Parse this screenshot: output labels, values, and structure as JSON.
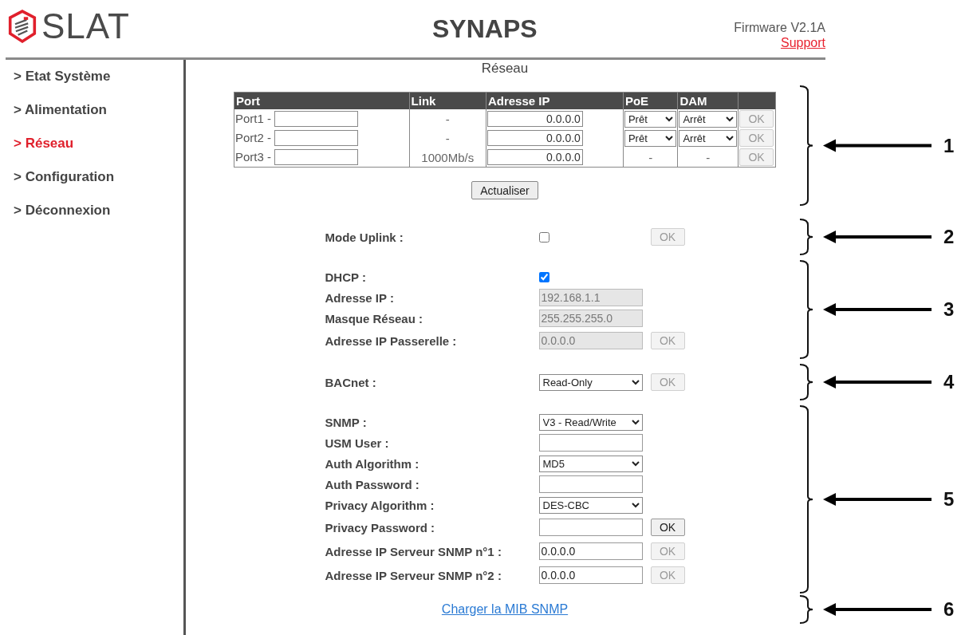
{
  "header": {
    "logo_text": "SLAT",
    "title": "SYNAPS",
    "firmware": "Firmware V2.1A",
    "support_link": "Support"
  },
  "sidebar": {
    "items": [
      {
        "label": "> Etat Système",
        "selected": false
      },
      {
        "label": "> Alimentation",
        "selected": false
      },
      {
        "label": "> Réseau",
        "selected": true
      },
      {
        "label": "> Configuration",
        "selected": false
      },
      {
        "label": "> Déconnexion",
        "selected": false
      }
    ]
  },
  "page_title": "Réseau",
  "ports_table": {
    "columns": [
      "Port",
      "Link",
      "Adresse IP",
      "PoE",
      "DAM"
    ],
    "rows": [
      {
        "port": "Port1 -",
        "link": "-",
        "ip": "0.0.0.0",
        "poe": {
          "kind": "select",
          "value": "Prêt"
        },
        "dam": {
          "kind": "select",
          "value": "Arrêt"
        },
        "ok": {
          "label": "OK",
          "disabled": true
        }
      },
      {
        "port": "Port2 -",
        "link": "-",
        "ip": "0.0.0.0",
        "poe": {
          "kind": "select",
          "value": "Prêt"
        },
        "dam": {
          "kind": "select",
          "value": "Arrêt"
        },
        "ok": {
          "label": "OK",
          "disabled": true
        }
      },
      {
        "port": "Port3 -",
        "link": "1000Mb/s",
        "ip": "0.0.0.0",
        "poe": {
          "kind": "text",
          "value": "-"
        },
        "dam": {
          "kind": "text",
          "value": "-"
        },
        "ok": {
          "label": "OK",
          "disabled": true
        }
      }
    ],
    "refresh_button": "Actualiser"
  },
  "form_groups": [
    {
      "rows": [
        {
          "label": "Mode Uplink :",
          "control": {
            "kind": "checkbox",
            "checked": false
          },
          "ok": {
            "label": "OK",
            "disabled": true
          }
        }
      ]
    },
    {
      "rows": [
        {
          "label": "DHCP :",
          "control": {
            "kind": "checkbox",
            "checked": true
          }
        },
        {
          "label": "Adresse IP :",
          "control": {
            "kind": "text",
            "value": "192.168.1.1",
            "disabled": true
          }
        },
        {
          "label": "Masque Réseau :",
          "control": {
            "kind": "text",
            "value": "255.255.255.0",
            "disabled": true
          }
        },
        {
          "label": "Adresse IP Passerelle :",
          "control": {
            "kind": "text",
            "value": "0.0.0.0",
            "disabled": true
          },
          "ok": {
            "label": "OK",
            "disabled": true
          }
        }
      ]
    },
    {
      "rows": [
        {
          "label": "BACnet :",
          "control": {
            "kind": "select",
            "value": "Read-Only"
          },
          "ok": {
            "label": "OK",
            "disabled": true
          }
        }
      ]
    },
    {
      "rows": [
        {
          "label": "SNMP :",
          "control": {
            "kind": "select",
            "value": "V3 - Read/Write"
          }
        },
        {
          "label": "USM User :",
          "control": {
            "kind": "text",
            "disabled": false
          }
        },
        {
          "label": "Auth Algorithm :",
          "control": {
            "kind": "select",
            "value": "MD5"
          }
        },
        {
          "label": "Auth Password :",
          "control": {
            "kind": "text",
            "disabled": false
          }
        },
        {
          "label": "Privacy Algorithm :",
          "control": {
            "kind": "select",
            "value": "DES-CBC"
          }
        },
        {
          "label": "Privacy Password :",
          "control": {
            "kind": "text",
            "disabled": false
          },
          "ok": {
            "label": "OK",
            "disabled": false
          }
        },
        {
          "label": "Adresse IP Serveur SNMP n°1 :",
          "control": {
            "kind": "text",
            "value": "0.0.0.0",
            "disabled": false
          },
          "ok": {
            "label": "OK",
            "disabled": true
          }
        },
        {
          "label": "Adresse IP Serveur SNMP n°2 :",
          "control": {
            "kind": "text",
            "value": "0.0.0.0",
            "disabled": false
          },
          "ok": {
            "label": "OK",
            "disabled": true
          }
        }
      ]
    }
  ],
  "mib_link": "Charger la MIB SNMP",
  "annotations": [
    {
      "number": "1"
    },
    {
      "number": "2"
    },
    {
      "number": "3"
    },
    {
      "number": "4"
    },
    {
      "number": "5"
    },
    {
      "number": "6"
    }
  ]
}
